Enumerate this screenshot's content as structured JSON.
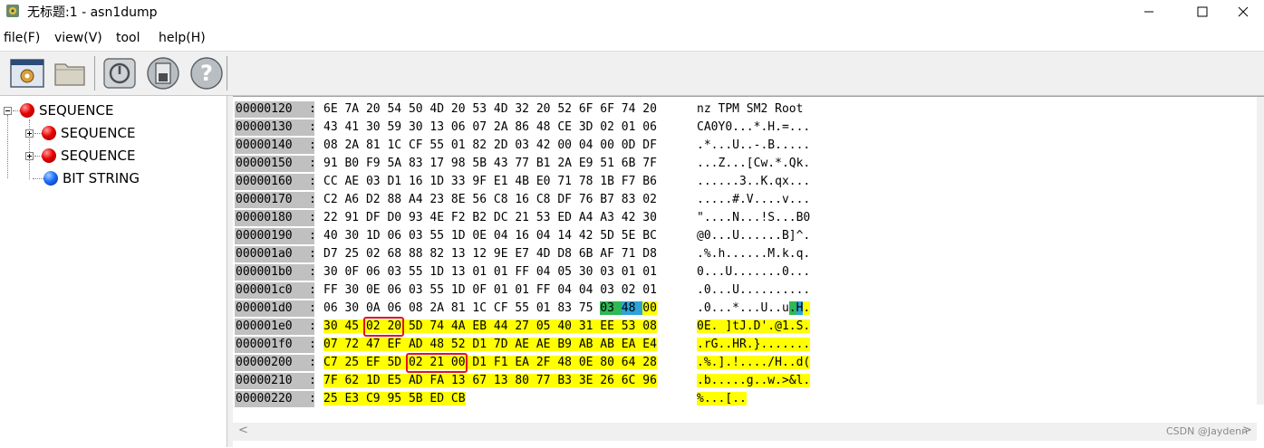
{
  "window": {
    "title": "无标题:1 - asn1dump",
    "minimize_symbol": "—",
    "maximize_symbol": "☐",
    "close_symbol": "✕"
  },
  "menu": [
    "file(F)",
    "view(V)",
    "tool",
    "help(H)"
  ],
  "toolbar": {
    "buttons": [
      "app-config-icon",
      "open-folder-icon",
      "power-icon",
      "save-disk-icon",
      "help-icon"
    ],
    "help_glyph": "?"
  },
  "tree": {
    "root": "SEQUENCE",
    "children": [
      "SEQUENCE",
      "SEQUENCE",
      "BIT STRING"
    ]
  },
  "hex": {
    "rows": [
      {
        "addr": "00000120",
        "bytes": "6E 7A 20 54 50 4D 20 53 4D 32 20 52 6F 6F 74 20",
        "ascii": "nz TPM SM2 Root "
      },
      {
        "addr": "00000130",
        "bytes": "43 41 30 59 30 13 06 07 2A 86 48 CE 3D 02 01 06",
        "ascii": "CA0Y0...*.H.=..."
      },
      {
        "addr": "00000140",
        "bytes": "08 2A 81 1C CF 55 01 82 2D 03 42 00 04 00 0D DF",
        "ascii": ".*...U..-.B....."
      },
      {
        "addr": "00000150",
        "bytes": "91 B0 F9 5A 83 17 98 5B 43 77 B1 2A E9 51 6B 7F",
        "ascii": "...Z...[Cw.*.Qk."
      },
      {
        "addr": "00000160",
        "bytes": "CC AE 03 D1 16 1D 33 9F E1 4B E0 71 78 1B F7 B6",
        "ascii": "......3..K.qx..."
      },
      {
        "addr": "00000170",
        "bytes": "C2 A6 D2 88 A4 23 8E 56 C8 16 C8 DF 76 B7 83 02",
        "ascii": ".....#.V....v..."
      },
      {
        "addr": "00000180",
        "bytes": "22 91 DF D0 93 4E F2 B2 DC 21 53 ED A4 A3 42 30",
        "ascii": "\"....N...!S...B0"
      },
      {
        "addr": "00000190",
        "bytes": "40 30 1D 06 03 55 1D 0E 04 16 04 14 42 5D 5E BC",
        "ascii": "@0...U......B]^."
      },
      {
        "addr": "000001a0",
        "bytes": "D7 25 02 68 88 82 13 12 9E E7 4D D8 6B AF 71 D8",
        "ascii": ".%.h......M.k.q."
      },
      {
        "addr": "000001b0",
        "bytes": "30 0F 06 03 55 1D 13 01 01 FF 04 05 30 03 01 01",
        "ascii": "0...U.......0..."
      },
      {
        "addr": "000001c0",
        "bytes": "FF 30 0E 06 03 55 1D 0F 01 01 FF 04 04 03 02 01",
        "ascii": ".0...U.........."
      },
      {
        "addr": "000001d0",
        "bytes": "06 30 0A 06 08 2A 81 1C CF 55 01 83 75 03 48 00",
        "ascii": ".0...*...U..u.H."
      },
      {
        "addr": "000001e0",
        "bytes": "30 45 02 20 5D 74 4A EB 44 27 05 40 31 EE 53 08",
        "ascii": "0E. ]tJ.D'.@1.S."
      },
      {
        "addr": "000001f0",
        "bytes": "07 72 47 EF AD 48 52 D1 7D AE AE B9 AB AB EA E4",
        "ascii": ".rG..HR.}......."
      },
      {
        "addr": "00000200",
        "bytes": "C7 25 EF 5D 02 21 00 D1 F1 EA 2F 48 0E 80 64 28",
        "ascii": ".%.].!..../H..d("
      },
      {
        "addr": "00000210",
        "bytes": "7F 62 1D E5 AD FA 13 67 13 80 77 B3 3E 26 6C 96",
        "ascii": ".b.....g..w.>&l."
      },
      {
        "addr": "00000220",
        "bytes": "25 E3 C9 95 5B ED CB",
        "ascii": "%...[.."
      }
    ],
    "colon": ":",
    "scroll_left": "<",
    "scroll_right": ">"
  },
  "watermark": "CSDN @Jaydenn"
}
